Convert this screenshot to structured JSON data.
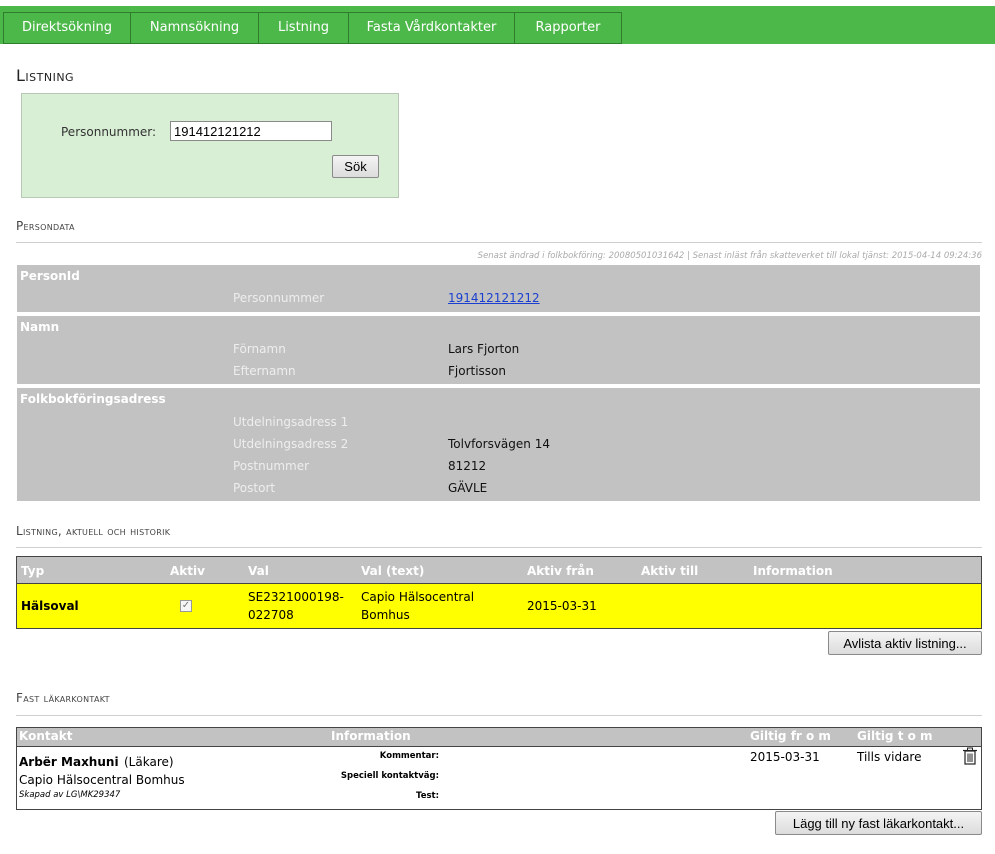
{
  "nav": {
    "items": [
      "Direktsökning",
      "Namnsökning",
      "Listning",
      "Fasta Vårdkontakter",
      "Rapporter"
    ]
  },
  "page_title": "Listning",
  "search": {
    "label": "Personnummer:",
    "value": "191412121212",
    "button": "Sök"
  },
  "persondata": {
    "heading": "Persondata",
    "meta": "Senast ändrad i folkbokföring: 20080501031642 | Senast inläst från skatteverket till lokal tjänst: 2015-04-14 09:24:36",
    "groups": {
      "personid": {
        "title": "PersonId",
        "personnummer_label": "Personnummer",
        "personnummer_value": "191412121212"
      },
      "namn": {
        "title": "Namn",
        "fornamn_label": "Förnamn",
        "fornamn_value": "Lars Fjorton",
        "efternamn_label": "Efternamn",
        "efternamn_value": "Fjortisson"
      },
      "adress": {
        "title": "Folkbokföringsadress",
        "utd1_label": "Utdelningsadress 1",
        "utd1_value": "",
        "utd2_label": "Utdelningsadress 2",
        "utd2_value": "Tolvforsvägen 14",
        "postnummer_label": "Postnummer",
        "postnummer_value": "81212",
        "postort_label": "Postort",
        "postort_value": "GÄVLE"
      }
    }
  },
  "listning": {
    "heading": "Listning, aktuell och historik",
    "headers": {
      "typ": "Typ",
      "aktiv": "Aktiv",
      "val": "Val",
      "val_text": "Val (text)",
      "aktiv_fran": "Aktiv från",
      "aktiv_till": "Aktiv till",
      "information": "Information"
    },
    "row": {
      "typ": "Hälsoval",
      "aktiv_checked": true,
      "val_line1": "SE2321000198-",
      "val_line2": "022708",
      "val_text_line1": "Capio Hälsocentral",
      "val_text_line2": "Bomhus",
      "aktiv_fran": "2015-03-31",
      "aktiv_till": "",
      "information": ""
    },
    "avlista_button": "Avlista aktiv listning..."
  },
  "fast": {
    "heading": "Fast läkarkontakt",
    "headers": {
      "kontakt": "Kontakt",
      "information": "Information",
      "giltig_from": "Giltig fr o m",
      "giltig_tom": "Giltig t o m"
    },
    "row": {
      "name": "Arbër Maxhuni",
      "role": "(Läkare)",
      "unit": "Capio Hälsocentral Bomhus",
      "created": "Skapad av LG\\MK29347",
      "kommentar_label": "Kommentar:",
      "kontaktvag_label": "Speciell kontaktväg:",
      "test_label": "Test:",
      "giltig_from": "2015-03-31",
      "giltig_tom": "Tills vidare"
    },
    "add_button": "Lägg till ny fast läkarkontakt..."
  }
}
